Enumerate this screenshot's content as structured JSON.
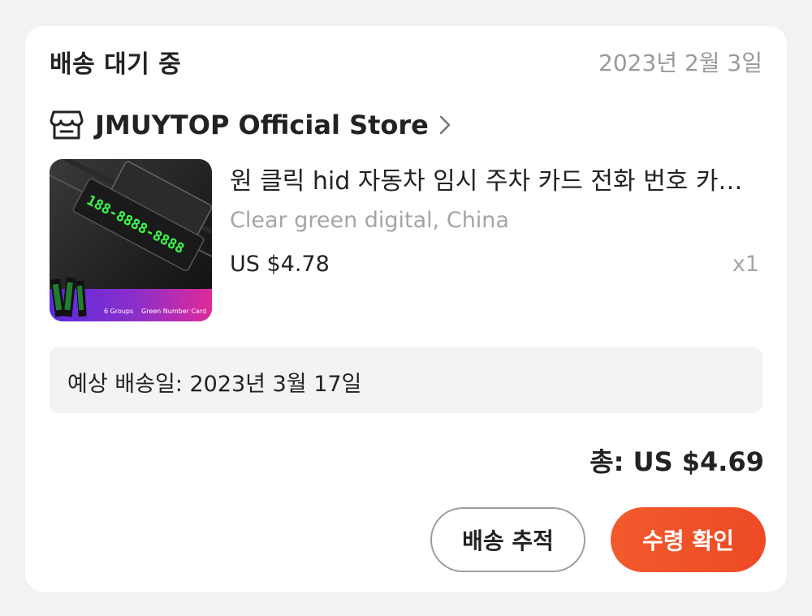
{
  "order": {
    "status": "배송 대기 중",
    "date": "2023년 2월 3일"
  },
  "store": {
    "name": "JMUYTOP Official Store",
    "icon": "store-icon"
  },
  "product": {
    "title": "원 클릭 hid 자동차 임시 주차 카드 전화 번호 카드 플레이트",
    "variant": "Clear green digital, China",
    "price": "US $4.78",
    "quantity": "x1",
    "image": {
      "number_text": "188-8888-8888",
      "caption_left": "6 Groups",
      "caption_right": "Green Number Card"
    }
  },
  "delivery": {
    "estimate": "예상 배송일: 2023년 3월 17일"
  },
  "summary": {
    "total": "총: US $4.69"
  },
  "actions": {
    "track_label": "배송 추적",
    "confirm_label": "수령 확인"
  },
  "colors": {
    "accent": "#f0542a",
    "text": "#222222",
    "muted": "#a5a5a5",
    "background": "#f2f2f2"
  }
}
